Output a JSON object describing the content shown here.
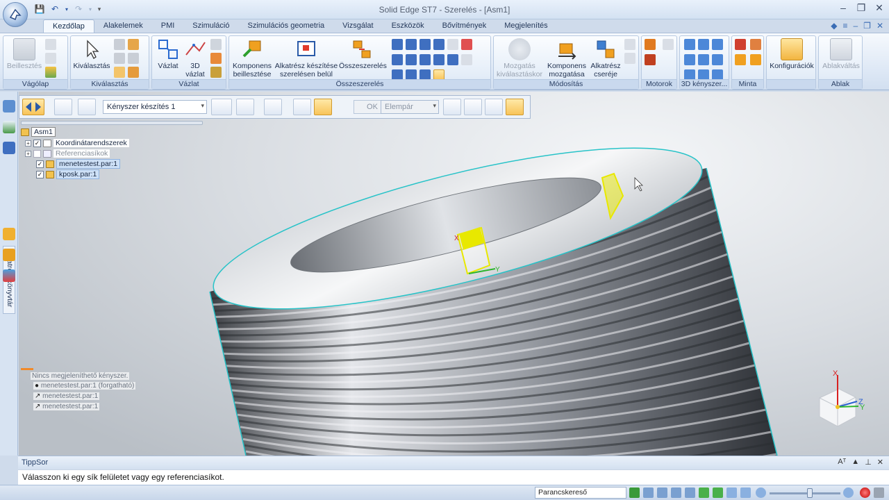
{
  "window": {
    "title": "Solid Edge ST7 - Szerelés - [Asm1]"
  },
  "ribbon": {
    "tabs": [
      "Kezdőlap",
      "Alakelemek",
      "PMI",
      "Szimuláció",
      "Szimulációs geometria",
      "Vizsgálat",
      "Eszközök",
      "Bővítmények",
      "Megjelenítés"
    ],
    "active_tab": "Kezdőlap",
    "groups": {
      "vagolap": {
        "label": "Vágólap",
        "paste": "Beillesztés"
      },
      "kivalasztas": {
        "label": "Kiválasztás",
        "select": "Kiválasztás"
      },
      "vazlat": {
        "label": "Vázlat",
        "sketch": "Vázlat",
        "sketch3d_line1": "3D",
        "sketch3d_line2": "vázlat"
      },
      "osszeszereles": {
        "label": "Összeszerelés",
        "insert_line1": "Komponens",
        "insert_line2": "beillesztése",
        "create_line1": "Alkatrész készítése",
        "create_line2": "szerelésen belül",
        "assemble": "Összeszerelés"
      },
      "modositas": {
        "label": "Módosítás",
        "drag_line1": "Mozgatás",
        "drag_line2": "kiválasztáskor",
        "move_line1": "Komponens",
        "move_line2": "mozgatása",
        "replace_line1": "Alkatrész",
        "replace_line2": "cseréje"
      },
      "motorok": {
        "label": "Motorok"
      },
      "kenyszer3d": {
        "label": "3D kényszer..."
      },
      "minta": {
        "label": "Minta"
      },
      "konfig": {
        "label": "",
        "configs": "Konfigurációk"
      },
      "ablak": {
        "label": "Ablak",
        "switch": "Ablakváltás"
      }
    }
  },
  "command_bar": {
    "relationship_dropdown": "Kényszer készítés 1",
    "ok_label": "OK",
    "pair_dropdown": "Elempár"
  },
  "left_strip": {
    "library_tab": "Alkatrészkönyvtár"
  },
  "tree": {
    "root": "Asm1",
    "items": [
      {
        "label": "Koordinátarendszerek",
        "checked": true,
        "state": "normal"
      },
      {
        "label": "Referenciasíkok",
        "checked": false,
        "state": "gray"
      },
      {
        "label": "menetestest.par:1",
        "checked": true,
        "state": "selected"
      },
      {
        "label": "kposk.par:1",
        "checked": true,
        "state": "selected"
      }
    ]
  },
  "constraints": {
    "header": "Nincs megjeleníthető kényszer.",
    "items": [
      "menetestest.par:1  (forgatható)",
      "menetestest.par:1",
      "menetestest.par:1"
    ]
  },
  "triad": {
    "x": "X",
    "y": "Y",
    "z": "Z"
  },
  "model": {
    "edge_color": "#27c3c8",
    "highlight_color": "#e8e800"
  },
  "prompt": {
    "title": "TippSor",
    "message": "Válasszon ki egy sík felületet vagy egy referenciasíkot."
  },
  "status": {
    "command_finder": "Parancskereső"
  }
}
